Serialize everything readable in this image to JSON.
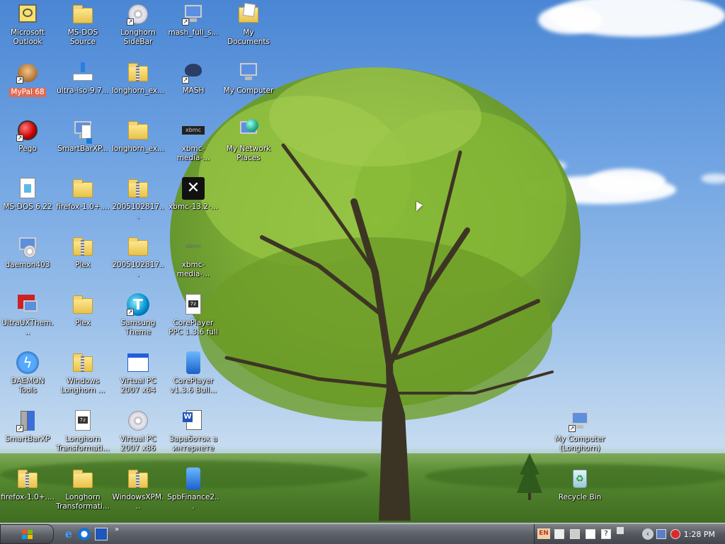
{
  "desktop": {
    "icons": [
      {
        "label": "Microsoft Outlook"
      },
      {
        "label": "MS-DOS Source"
      },
      {
        "label": "Longhorn SideBar"
      },
      {
        "label": "mash_full_s..."
      },
      {
        "label": "My Documents"
      },
      {
        "label": "MyPal 68"
      },
      {
        "label": "ultra-iso-9.7..."
      },
      {
        "label": "longhorn_ex..."
      },
      {
        "label": "MASH"
      },
      {
        "label": "My Computer"
      },
      {
        "label": "Pego"
      },
      {
        "label": "SmartBarXP..."
      },
      {
        "label": "longhorn_ex..."
      },
      {
        "label": "xbmc-media-..."
      },
      {
        "label": "My Network Places"
      },
      {
        "label": "MS-DOS 6.22"
      },
      {
        "label": "firefox-1.0+...."
      },
      {
        "label": "2005102817..."
      },
      {
        "label": "xbmc-13.2-..."
      },
      {
        "label": "daemon403"
      },
      {
        "label": "Plex"
      },
      {
        "label": "2005102817..."
      },
      {
        "label": "xbmc-media-..."
      },
      {
        "label": "UltraUXThem..."
      },
      {
        "label": "Plex"
      },
      {
        "label": "Samsung Theme"
      },
      {
        "label": "CorePlayer PPC 1.3.6 full"
      },
      {
        "label": "DAEMON Tools"
      },
      {
        "label": "Windows Longhorn ..."
      },
      {
        "label": "Virtual PC 2007 x64"
      },
      {
        "label": "CorePlayer v1.3.6 Buil..."
      },
      {
        "label": "SmartBarXP"
      },
      {
        "label": "Longhorn Transformati..."
      },
      {
        "label": "Virtual PC 2007 x86"
      },
      {
        "label": "Заработок в интернете"
      },
      {
        "label": "firefox-1.0+...."
      },
      {
        "label": "Longhorn Transformati..."
      },
      {
        "label": "WindowsXPM..."
      },
      {
        "label": "SpbFinance2..."
      },
      {
        "label": "My Computer (Longhorn)"
      },
      {
        "label": "Recycle Bin"
      }
    ]
  },
  "taskbar": {
    "quicklaunch_more": "»",
    "tray": {
      "language": "EN",
      "clock": "1:28 PM",
      "expand_arrow": "‹"
    }
  },
  "icon_names": {
    "ie": "internet-explorer-icon",
    "show_desktop": "show-desktop-icon"
  }
}
